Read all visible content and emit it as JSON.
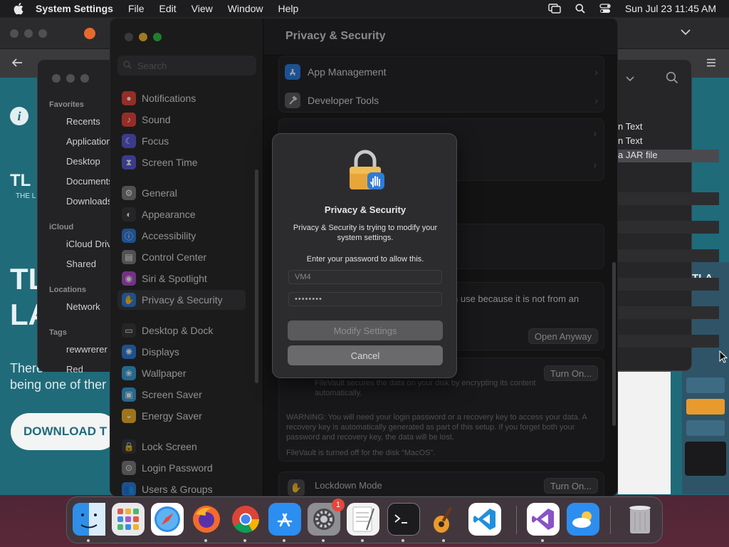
{
  "menubar": {
    "app_name": "System Settings",
    "menus": [
      "File",
      "Edit",
      "View",
      "Window",
      "Help"
    ],
    "datetime": "Sun Jul 23  11:45 AM"
  },
  "finder": {
    "sections": {
      "favorites": "Favorites",
      "icloud": "iCloud",
      "locations": "Locations",
      "tags": "Tags"
    },
    "items": {
      "recents": "Recents",
      "applications": "Applications",
      "desktop": "Desktop",
      "documents": "Documents",
      "downloads": "Downloads",
      "icloud_drive": "iCloud Drive",
      "shared": "Shared",
      "network": "Network",
      "tag1": "rewwrerer",
      "tag2": "Red"
    },
    "files": [
      "n Text",
      "n Text",
      "a JAR file"
    ]
  },
  "browser_page": {
    "brand_small": "TL",
    "brand_sub": "THE L",
    "headline_1": "TL",
    "headline_2": "LA",
    "text_1": "There",
    "text_2": "being one of ther",
    "download": "DOWNLOAD T"
  },
  "settings": {
    "search_placeholder": "Search",
    "title": "Privacy & Security",
    "sidebar": [
      {
        "label": "Notifications",
        "color": "#e5453c",
        "glyph": "●"
      },
      {
        "label": "Sound",
        "color": "#e5453c",
        "glyph": "♪"
      },
      {
        "label": "Focus",
        "color": "#5b5bd6",
        "glyph": "☾"
      },
      {
        "label": "Screen Time",
        "color": "#5b5bd6",
        "glyph": "⧗"
      },
      {
        "label": "General",
        "color": "#7d7d80",
        "glyph": "⚙"
      },
      {
        "label": "Appearance",
        "color": "#3a3a3c",
        "glyph": "◐"
      },
      {
        "label": "Accessibility",
        "color": "#2f7bd8",
        "glyph": "ⓘ"
      },
      {
        "label": "Control Center",
        "color": "#7d7d80",
        "glyph": "▤"
      },
      {
        "label": "Siri & Spotlight",
        "color": "#b04fc8",
        "glyph": "◉"
      },
      {
        "label": "Privacy & Security",
        "color": "#2f7bd8",
        "glyph": "✋"
      },
      {
        "label": "Desktop & Dock",
        "color": "#3a3a3c",
        "glyph": "▭"
      },
      {
        "label": "Displays",
        "color": "#2f7bd8",
        "glyph": "✺"
      },
      {
        "label": "Wallpaper",
        "color": "#3aa0d8",
        "glyph": "❀"
      },
      {
        "label": "Screen Saver",
        "color": "#3aa0d8",
        "glyph": "▣"
      },
      {
        "label": "Energy Saver",
        "color": "#f0b429",
        "glyph": "◒"
      },
      {
        "label": "Lock Screen",
        "color": "#3a3a3c",
        "glyph": "🔒"
      },
      {
        "label": "Login Password",
        "color": "#7d7d80",
        "glyph": "⊙"
      },
      {
        "label": "Users & Groups",
        "color": "#2f7bd8",
        "glyph": "👥"
      }
    ],
    "rows": {
      "app_management": "App Management",
      "developer_tools": "Developer Tools"
    },
    "blocked_text_1": "n use because it is not from an",
    "open_anyway": "Open Anyway",
    "turn_on_1": "Turn On...",
    "filevault_desc": "FileVault secures the data on your disk by encrypting its content automatically.",
    "warning": "WARNING: You will need your login password or a recovery key to access your data. A recovery key is automatically generated as part of this setup. If you forget both your password and recovery key, the data will be lost.",
    "filevault_status": "FileVault is turned off for the disk “MacOS”.",
    "lockdown_title": "Lockdown Mode",
    "turn_on_2": "Turn On..."
  },
  "dialog": {
    "title": "Privacy & Security",
    "message": "Privacy & Security is trying to modify your system settings.",
    "prompt": "Enter your password to allow this.",
    "username_placeholder": "VM4",
    "password_value": "••••••••",
    "modify_button": "Modify Settings",
    "cancel_button": "Cancel"
  },
  "dock": {
    "apps": [
      {
        "name": "Finder",
        "bg": "#2f8fe8"
      },
      {
        "name": "Launchpad",
        "bg": "#e9e9ec"
      },
      {
        "name": "Safari",
        "bg": "#ffffff"
      },
      {
        "name": "Firefox",
        "bg": "#3b2a6b"
      },
      {
        "name": "Chrome",
        "bg": "#ffffff"
      },
      {
        "name": "App Store",
        "bg": "#2b8ef0"
      },
      {
        "name": "System Settings",
        "bg": "#8e8e93"
      },
      {
        "name": "TextEdit",
        "bg": "#f2f2f2"
      },
      {
        "name": "Terminal",
        "bg": "#1c1c1e"
      },
      {
        "name": "GarageBand",
        "bg": "#3a2418"
      },
      {
        "name": "Visual Studio Code",
        "bg": "#ffffff"
      },
      {
        "name": "Visual Studio",
        "bg": "#ffffff"
      },
      {
        "name": "Weather",
        "bg": "#2d8ef0"
      },
      {
        "name": "Trash",
        "bg": "#4a4a4e"
      }
    ],
    "badge_count": "1"
  }
}
